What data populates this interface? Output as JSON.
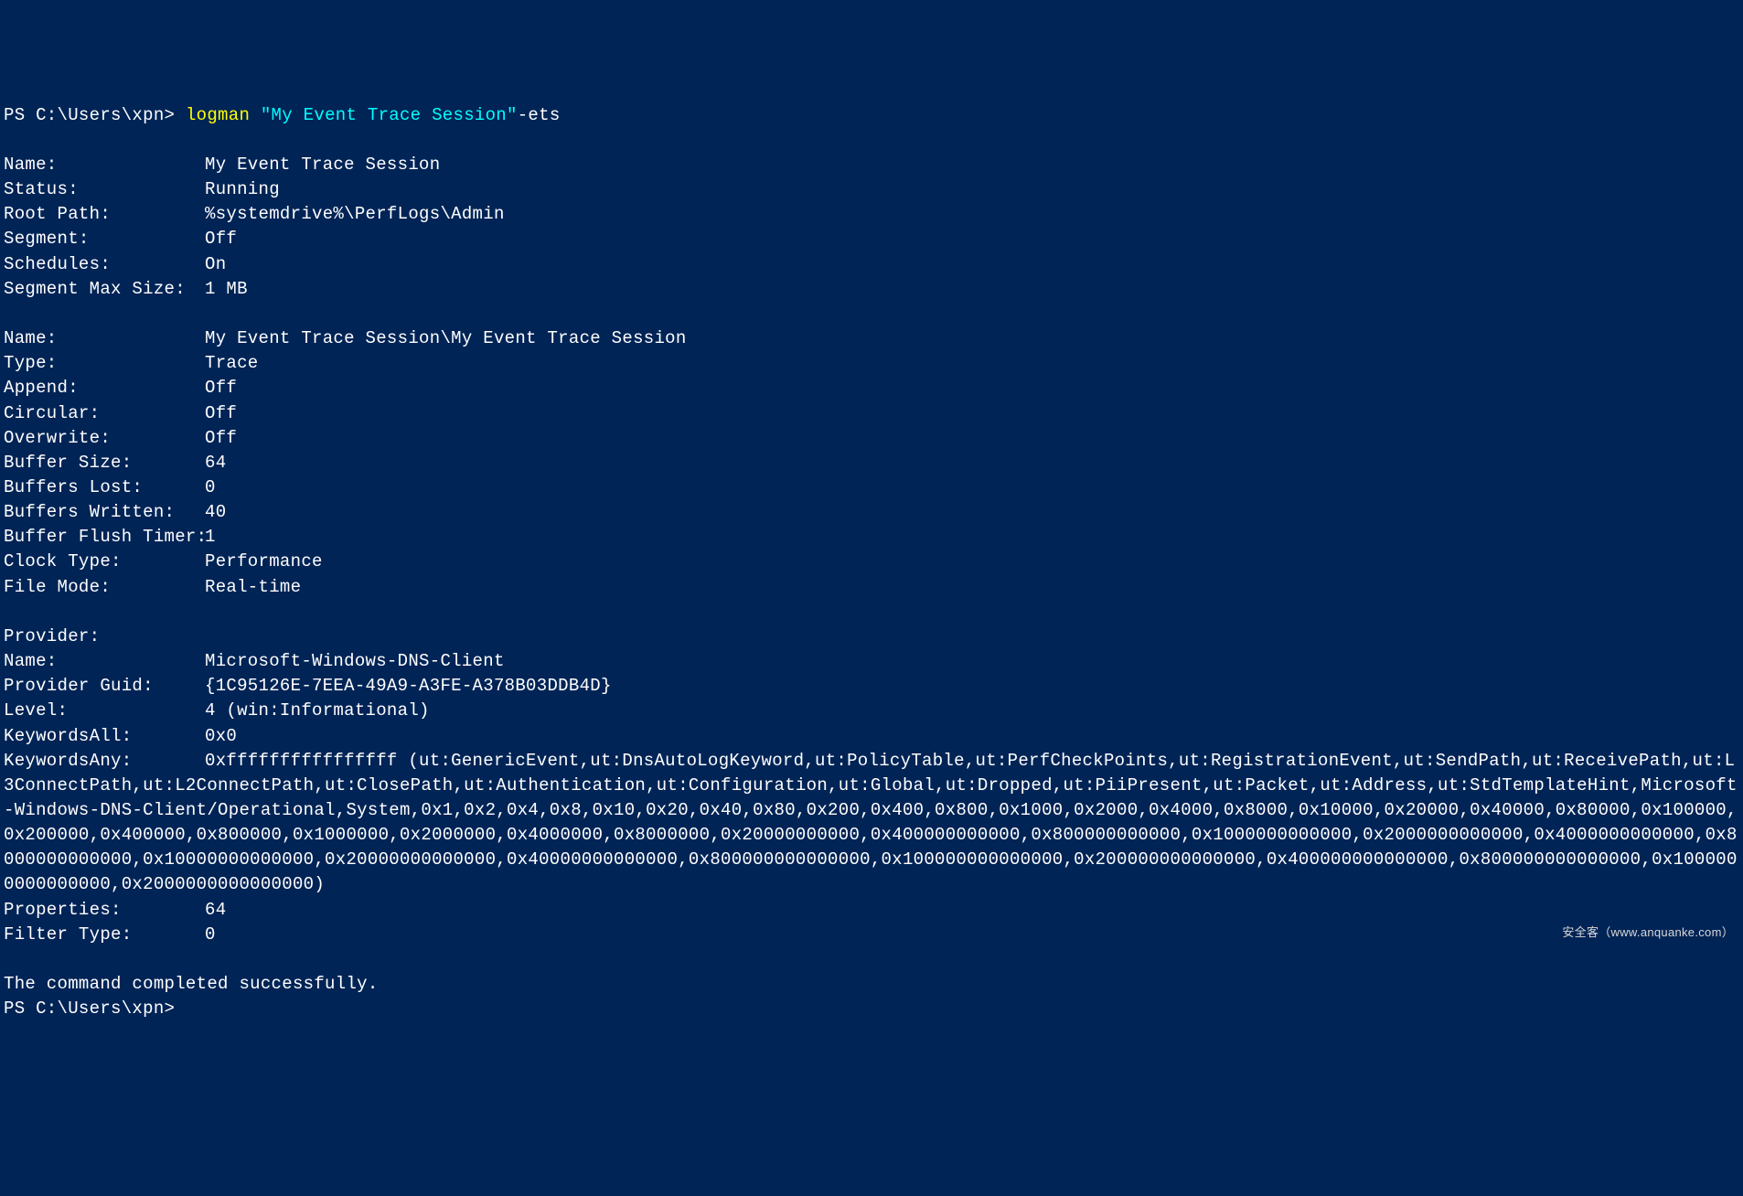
{
  "prompt": {
    "prefix": "PS C:\\Users\\xpn> ",
    "command": "logman ",
    "arg_quoted": "\"My Event Trace Session\"",
    "arg_flag": "-ets"
  },
  "session": {
    "name_label": "Name:",
    "name": "My Event Trace Session",
    "status_label": "Status:",
    "status": "Running",
    "root_path_label": "Root Path:",
    "root_path": "%systemdrive%\\PerfLogs\\Admin",
    "segment_label": "Segment:",
    "segment": "Off",
    "schedules_label": "Schedules:",
    "schedules": "On",
    "segment_max_size_label": "Segment Max Size:",
    "segment_max_size": "1 MB"
  },
  "trace": {
    "name_label": "Name:",
    "name": "My Event Trace Session\\My Event Trace Session",
    "type_label": "Type:",
    "type": "Trace",
    "append_label": "Append:",
    "append": "Off",
    "circular_label": "Circular:",
    "circular": "Off",
    "overwrite_label": "Overwrite:",
    "overwrite": "Off",
    "buffer_size_label": "Buffer Size:",
    "buffer_size": "64",
    "buffers_lost_label": "Buffers Lost:",
    "buffers_lost": "0",
    "buffers_written_label": "Buffers Written:",
    "buffers_written": "40",
    "buffer_flush_timer_label": "Buffer Flush Timer:",
    "buffer_flush_timer": "1",
    "clock_type_label": "Clock Type:",
    "clock_type": "Performance",
    "file_mode_label": "File Mode:",
    "file_mode": "Real-time"
  },
  "provider": {
    "header": "Provider:",
    "name_label": "Name:",
    "name": "Microsoft-Windows-DNS-Client",
    "guid_label": "Provider Guid:",
    "guid": "{1C95126E-7EEA-49A9-A3FE-A378B03DDB4D}",
    "level_label": "Level:",
    "level": "4 (win:Informational)",
    "keywords_all_label": "KeywordsAll:",
    "keywords_all": "0x0",
    "keywords_any_label": "KeywordsAny:",
    "keywords_any": "0xffffffffffffffff (ut:GenericEvent,ut:DnsAutoLogKeyword,ut:PolicyTable,ut:PerfCheckPoints,ut:RegistrationEvent,ut:SendPath,ut:ReceivePath,ut:L3ConnectPath,ut:L2ConnectPath,ut:ClosePath,ut:Authentication,ut:Configuration,ut:Global,ut:Dropped,ut:PiiPresent,ut:Packet,ut:Address,ut:StdTemplateHint,Microsoft-Windows-DNS-Client/Operational,System,0x1,0x2,0x4,0x8,0x10,0x20,0x40,0x80,0x200,0x400,0x800,0x1000,0x2000,0x4000,0x8000,0x10000,0x20000,0x40000,0x80000,0x100000,0x200000,0x400000,0x800000,0x1000000,0x2000000,0x4000000,0x8000000,0x20000000000,0x400000000000,0x800000000000,0x1000000000000,0x2000000000000,0x4000000000000,0x8000000000000,0x10000000000000,0x20000000000000,0x40000000000000,0x800000000000000,0x100000000000000,0x200000000000000,0x400000000000000,0x800000000000000,0x1000000000000000,0x2000000000000000)",
    "properties_label": "Properties:",
    "properties": "64",
    "filter_type_label": "Filter Type:",
    "filter_type": "0"
  },
  "completion": "The command completed successfully.",
  "prompt_end": "PS C:\\Users\\xpn>",
  "footer": "安全客（www.anquanke.com）"
}
